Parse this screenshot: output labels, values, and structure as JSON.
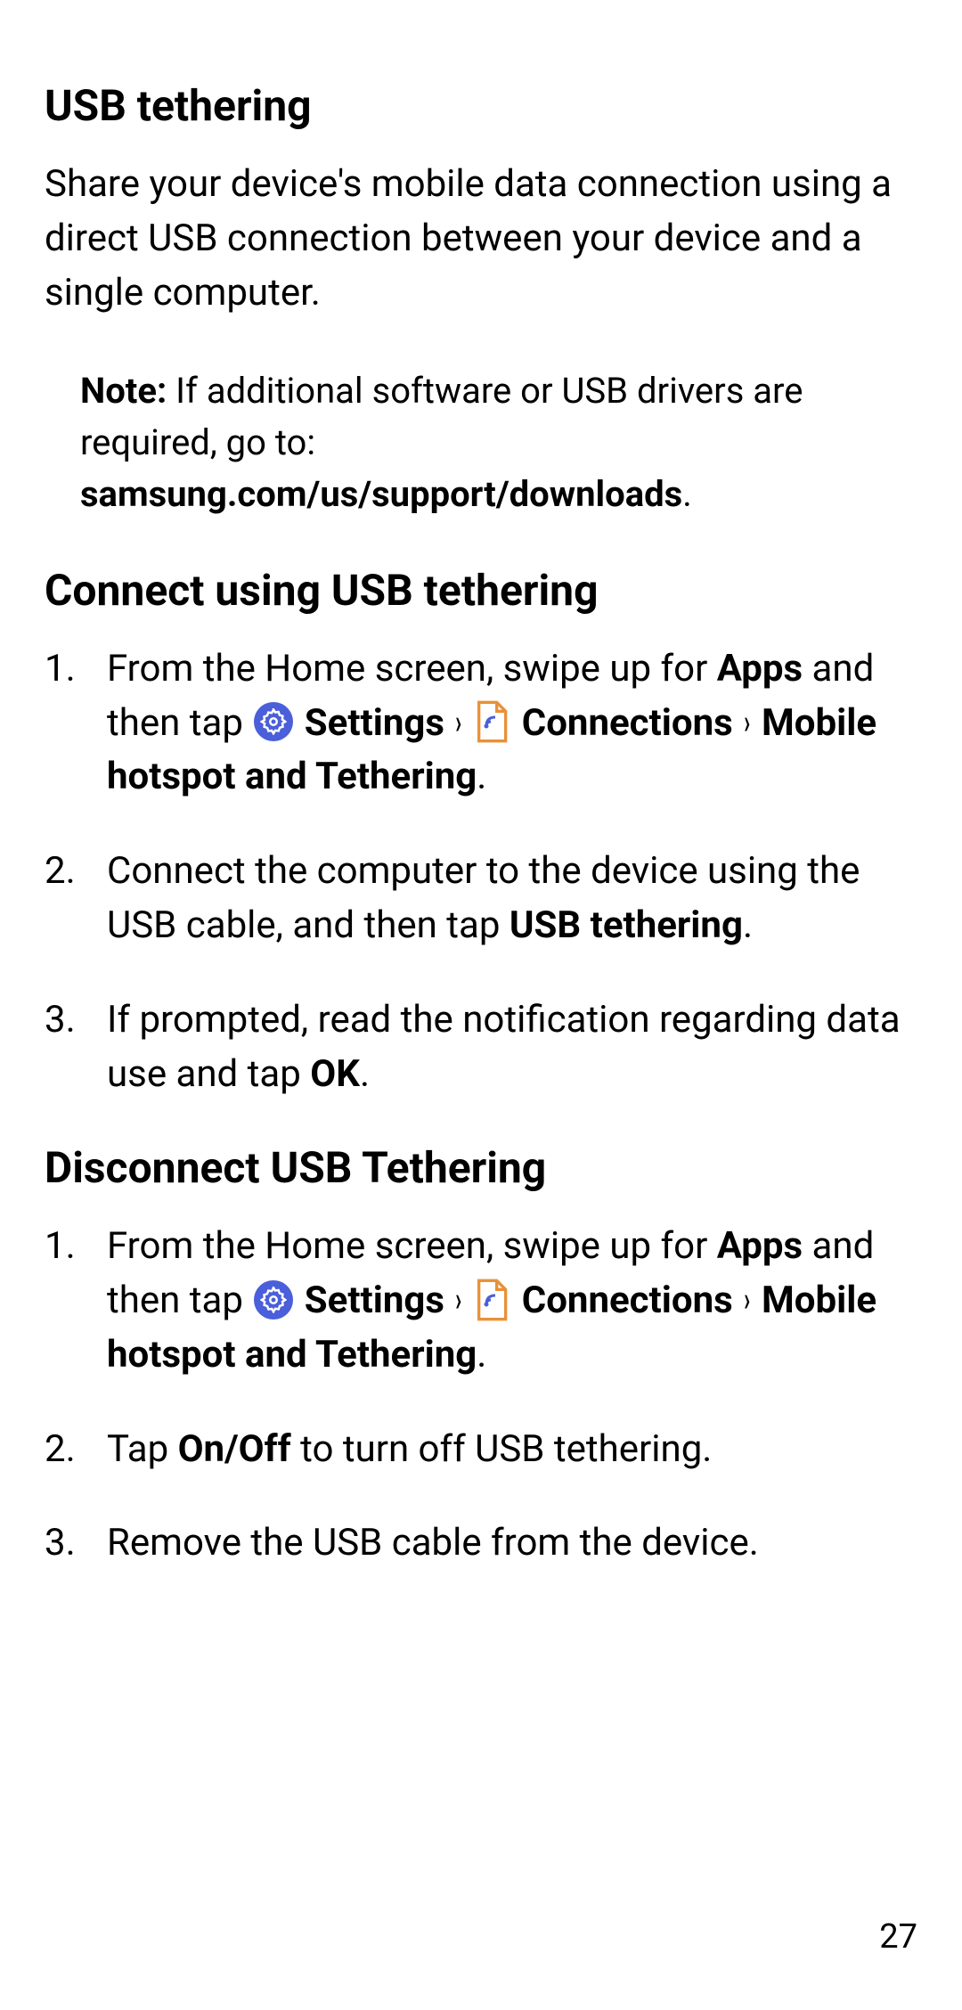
{
  "title1": "USB tethering",
  "intro": "Share your device's mobile data connection using a direct USB connection between your device and a single computer.",
  "noteLabel": "Note:",
  "noteText1": " If additional software or USB drivers are required, go to: ",
  "noteBold": "samsung.com/us/support/downloads",
  "noteText2": ".",
  "title2": "Connect using USB tethering",
  "connect": {
    "s1a": "From the Home screen, swipe up for ",
    "s1_apps": "Apps",
    "s1b": " and then tap ",
    "s1_settings": " Settings",
    "s1c": " ",
    "s1_connections": " Connections",
    "s1d": " ",
    "s1_hotspot": " Mobile hotspot and Tethering",
    "s1e": ".",
    "s2a": "Connect the computer to the device using the USB cable, and then tap ",
    "s2_usb": "USB tethering",
    "s2b": ".",
    "s3a": "If prompted, read the notification regarding data use and tap ",
    "s3_ok": "OK",
    "s3b": "."
  },
  "title3": "Disconnect USB Tethering",
  "disconnect": {
    "s1a": "From the Home screen, swipe up for ",
    "s1_apps": "Apps",
    "s1b": " and then tap ",
    "s1_settings": " Settings",
    "s1c": " ",
    "s1_connections": " Connections",
    "s1d": " ",
    "s1_hotspot": " Mobile hotspot and Tethering",
    "s1e": ".",
    "s2a": "Tap ",
    "s2_onoff": "On/Off",
    "s2b": " to turn off USB tethering.",
    "s3": "Remove the USB cable from the device."
  },
  "chevron": "›",
  "pageNumber": "27"
}
